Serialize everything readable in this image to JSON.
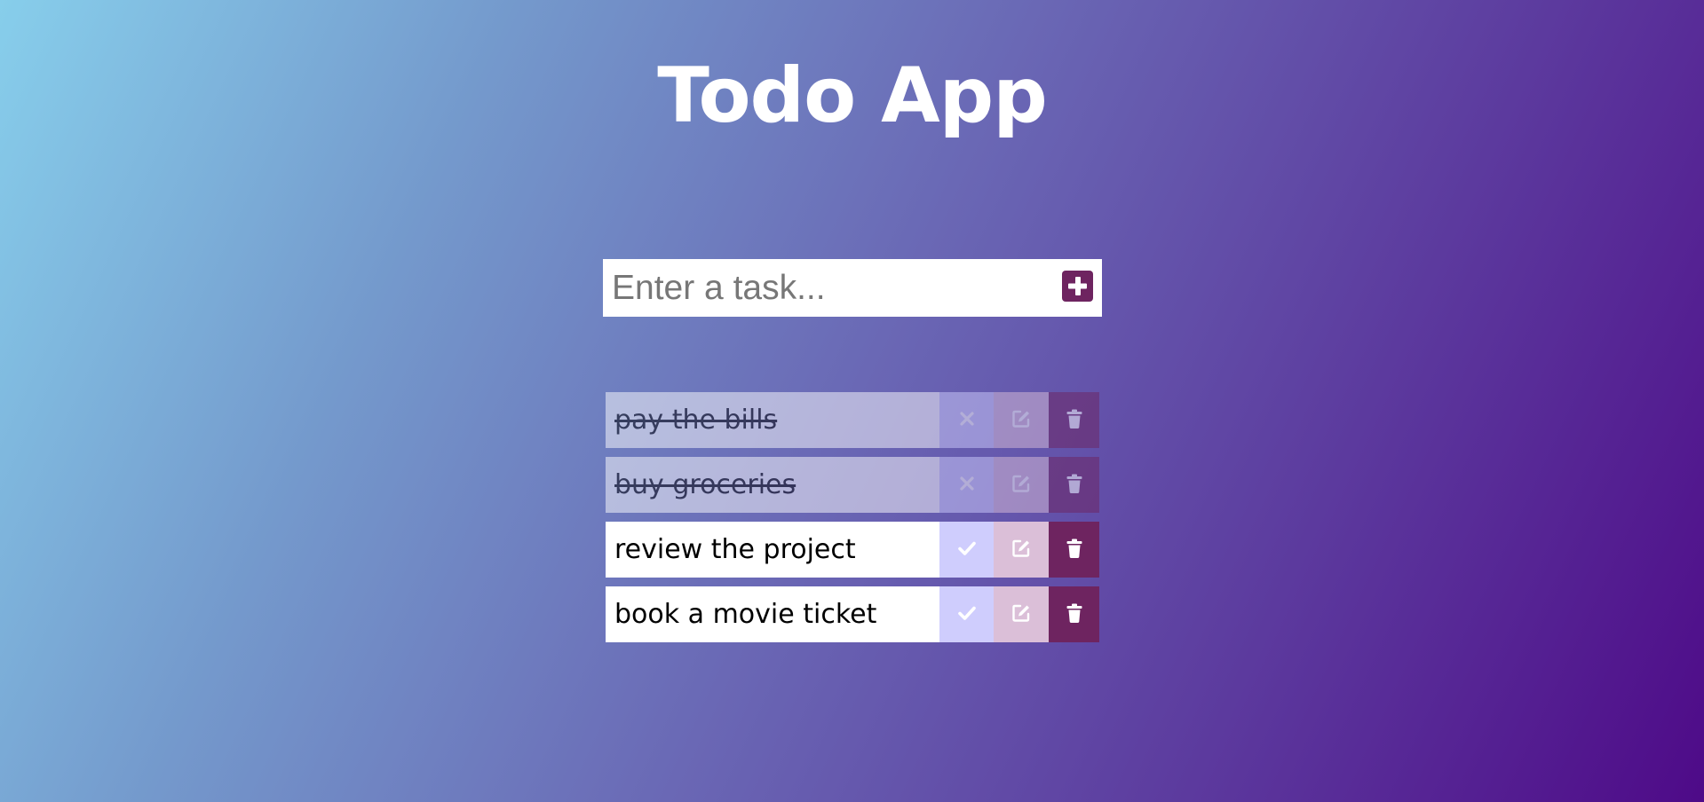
{
  "app": {
    "title": "Todo App"
  },
  "form": {
    "placeholder": "Enter a task...",
    "value": "",
    "add_icon": "plus-square-icon"
  },
  "todos": [
    {
      "text": "pay the bills",
      "completed": true
    },
    {
      "text": "buy groceries",
      "completed": true
    },
    {
      "text": "review the project",
      "completed": false
    },
    {
      "text": "book a movie ticket",
      "completed": false
    }
  ],
  "icons": {
    "complete": "check-icon",
    "uncomplete": "x-icon",
    "edit": "edit-icon",
    "delete": "trash-icon"
  },
  "colors": {
    "accent": "#6e2460",
    "complete_button": "#cfcdfd",
    "edit_button": "#dbbfd8",
    "gradient_start": "#87ceeb",
    "gradient_end": "#4e0a88"
  }
}
